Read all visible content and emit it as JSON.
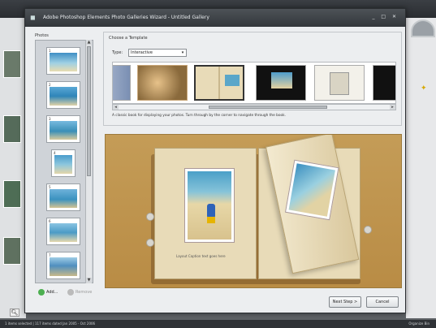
{
  "dialog": {
    "title": "Adobe Photoshop Elements Photo Galleries Wizard - Untitled Gallery",
    "window_buttons": "_ □ ✕"
  },
  "photos": {
    "label": "Photos",
    "items": [
      {
        "num": "1"
      },
      {
        "num": "2"
      },
      {
        "num": "3"
      },
      {
        "num": "4"
      },
      {
        "num": "5"
      },
      {
        "num": "6"
      },
      {
        "num": "7"
      }
    ],
    "add_label": "Add...",
    "remove_label": "Remove"
  },
  "templates": {
    "group_label": "Choose a Template",
    "type_label": "Type:",
    "type_value": "Interactive",
    "description": "A classic book for displaying your photos. Turn through by the corner to navigate through the book."
  },
  "preview": {
    "caption": "Layout Caption text goes here"
  },
  "buttons": {
    "next": "Next Step >",
    "cancel": "Cancel"
  },
  "status": {
    "left": "1 items selected  |  117 items dated Jan 2005 - Oct 2006",
    "right": "Organize Bin"
  },
  "colors": {
    "preview_bg": "#c49c57",
    "dialog_bg": "#eceef0",
    "titlebar": "#3b3f44"
  }
}
